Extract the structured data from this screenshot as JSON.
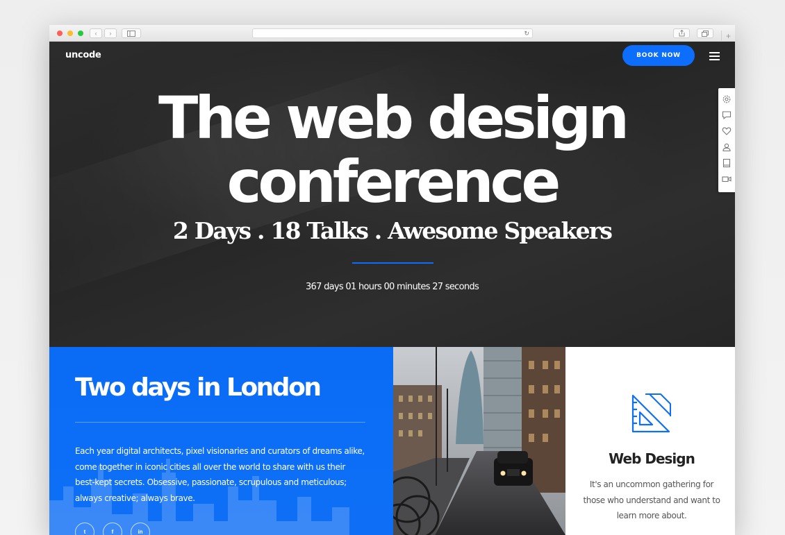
{
  "browser": {
    "back_glyph": "‹",
    "forward_glyph": "›",
    "reload_glyph": "↻",
    "new_tab_glyph": "+"
  },
  "header": {
    "logo": "uncode",
    "book_button": "BOOK NOW",
    "menu_icon": "hamburger-icon"
  },
  "hero": {
    "title_line1": "The web design",
    "title_line2": "conference",
    "subtitle": "2 Days . 18 Talks . Awesome Speakers",
    "countdown": "367 days 01 hours 00 minutes 27 seconds",
    "accent_color": "#0d6efd"
  },
  "side_toolbar": {
    "icons": [
      "gear-icon",
      "chat-icon",
      "heart-icon",
      "user-icon",
      "book-icon",
      "video-icon"
    ]
  },
  "london": {
    "title": "Two days in London",
    "text": "Each year digital architects, pixel visionaries and curators of dreams alike, come together in iconic cities all over the world to share with us their best-kept secrets. Obsessive, passionate, scrupulous and meticulous; always creative; always brave.",
    "social": [
      "t",
      "f",
      "in"
    ],
    "background_color": "#0a6cf5"
  },
  "feature": {
    "icon": "ruler-triangle-icon",
    "title": "Web Design",
    "text": "It's an uncommon gathering for those who understand and want to learn more about."
  }
}
